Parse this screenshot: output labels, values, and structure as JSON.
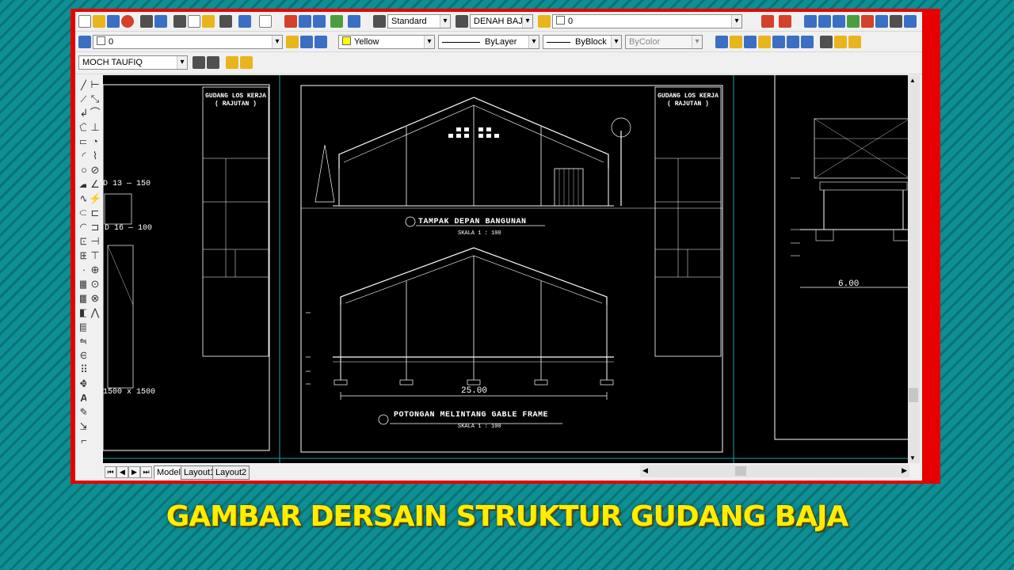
{
  "toolbar1": {
    "text_style": "Standard",
    "dim_style": "DENAH BAJA E",
    "layer_state": "0"
  },
  "toolbar2": {
    "layer": "0",
    "color": "Yellow",
    "linetype": "ByLayer",
    "lineweight": "ByBlock",
    "plotstyle": "ByColor"
  },
  "toolbar3": {
    "workspace": "MOCH TAUFIQ"
  },
  "tabs": [
    "Model",
    "Layout1",
    "Layout2"
  ],
  "drawing": {
    "left_sheet_title": "GUDANG LOS KERJA",
    "left_sheet_sub": "( RAJUTAN )",
    "left_label_1": "D 13 — 150",
    "left_label_2": "D 16 — 100",
    "left_label_3": "1500 x 1500",
    "front_view_title": "TAMPAK DEPAN BANGUNAN",
    "front_view_scale": "SKALA 1 : 100",
    "section_title": "POTONGAN MELINTANG GABLE FRAME",
    "section_scale": "SKALA 1 : 100",
    "section_width": "25.00",
    "right_sheet_title": "GUDANG LOS KERJA",
    "right_sheet_sub": "( RAJUTAN )",
    "side_width": "6.00"
  },
  "caption": "GAMBAR DERSAIN STRUKTUR GUDANG BAJA"
}
